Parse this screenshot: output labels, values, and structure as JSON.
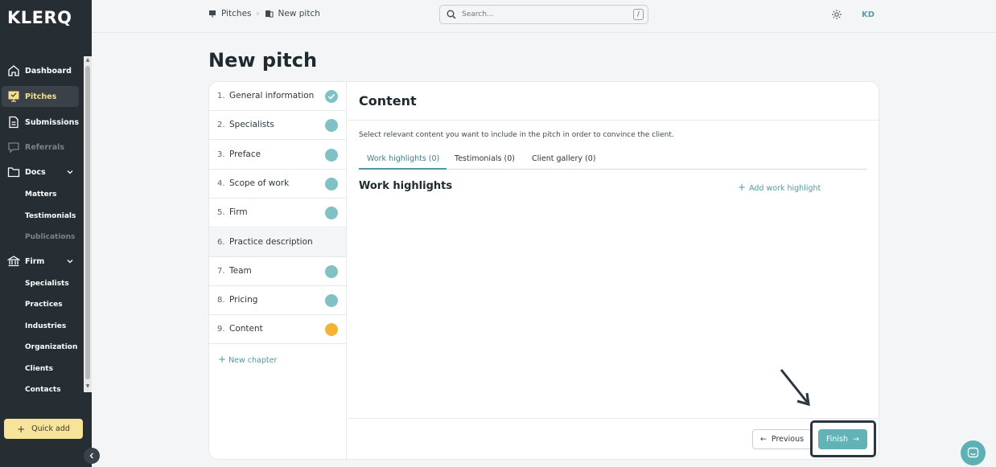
{
  "app": {
    "logo": "KLERQ"
  },
  "sidebar": {
    "items": [
      {
        "label": "Dashboard",
        "icon": "home-icon"
      },
      {
        "label": "Pitches",
        "icon": "presentation-icon",
        "active": true
      },
      {
        "label": "Submissions",
        "icon": "document-icon"
      },
      {
        "label": "Referrals",
        "icon": "chat-icon",
        "dimmed": true
      },
      {
        "label": "Docs",
        "icon": "folder-icon"
      },
      {
        "label": "Firm",
        "icon": "bank-icon"
      }
    ],
    "docs_sub": [
      "Matters",
      "Testimonials",
      "Publications"
    ],
    "firm_sub": [
      "Specialists",
      "Practices",
      "Industries",
      "Organization",
      "Clients",
      "Contacts"
    ],
    "quick_add": "Quick add"
  },
  "topbar": {
    "breadcrumb": [
      "Pitches",
      "New pitch"
    ],
    "search_placeholder": "Search...",
    "search_shortcut": "/",
    "avatar_initials": "KD"
  },
  "page": {
    "title": "New pitch"
  },
  "steps": [
    {
      "num": "1.",
      "name": "General information",
      "status": "done"
    },
    {
      "num": "2.",
      "name": "Specialists",
      "status": "complete"
    },
    {
      "num": "3.",
      "name": "Preface",
      "status": "complete"
    },
    {
      "num": "4.",
      "name": "Scope of work",
      "status": "complete"
    },
    {
      "num": "5.",
      "name": "Firm",
      "status": "complete"
    },
    {
      "num": "6.",
      "name": "Practice description",
      "status": "none"
    },
    {
      "num": "7.",
      "name": "Team",
      "status": "complete"
    },
    {
      "num": "8.",
      "name": "Pricing",
      "status": "complete"
    },
    {
      "num": "9.",
      "name": "Content",
      "status": "current"
    }
  ],
  "new_chapter": "New chapter",
  "content": {
    "title": "Content",
    "description": "Select relevant content you want to include in the pitch in order to convince the client.",
    "tabs": [
      "Work highlights (0)",
      "Testimonials (0)",
      "Client gallery (0)"
    ],
    "section_title": "Work highlights",
    "add_label": "Add work highlight"
  },
  "footer": {
    "previous": "Previous",
    "finish": "Finish"
  },
  "colors": {
    "accent": "#62b3b8",
    "complete": "#7fc1c4",
    "current": "#f5b335",
    "sidebar": "#262d33",
    "pitches_active": "#f6df8b"
  }
}
